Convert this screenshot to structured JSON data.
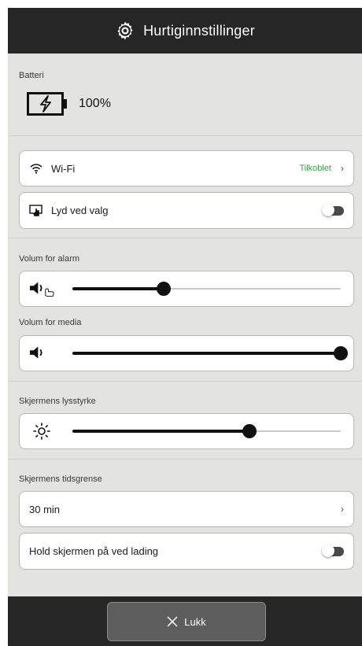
{
  "header": {
    "title": "Hurtiginnstillinger",
    "icon": "gear-icon"
  },
  "battery": {
    "label": "Batteri",
    "percent_text": "100%",
    "level": 1.0,
    "icon": "battery-charging-icon"
  },
  "wifi": {
    "label": "Wi-Fi",
    "status": "Tilkoblet",
    "status_color": "#3e9a4a",
    "icon": "wifi-icon"
  },
  "touch_sound": {
    "label": "Lyd ved valg",
    "enabled": false,
    "icon": "touch-sound-icon"
  },
  "alarm_volume": {
    "label": "Volum for alarm",
    "level": 0.34,
    "icon": "speaker-hand-icon"
  },
  "media_volume": {
    "label": "Volum for media",
    "level": 1.0,
    "icon": "speaker-icon"
  },
  "brightness": {
    "label": "Skjermens lysstyrke",
    "level": 0.66,
    "icon": "sun-icon"
  },
  "screen_timeout": {
    "label": "Skjermens tidsgrense",
    "value": "30 min"
  },
  "stay_awake": {
    "label": "Hold skjermen på ved lading",
    "enabled": false
  },
  "footer": {
    "close_label": "Lukk",
    "icon": "close-icon"
  },
  "colors": {
    "header_bg": "#262626",
    "panel_bg": "#e3e3e1",
    "accent_green": "#3e9a4a"
  }
}
